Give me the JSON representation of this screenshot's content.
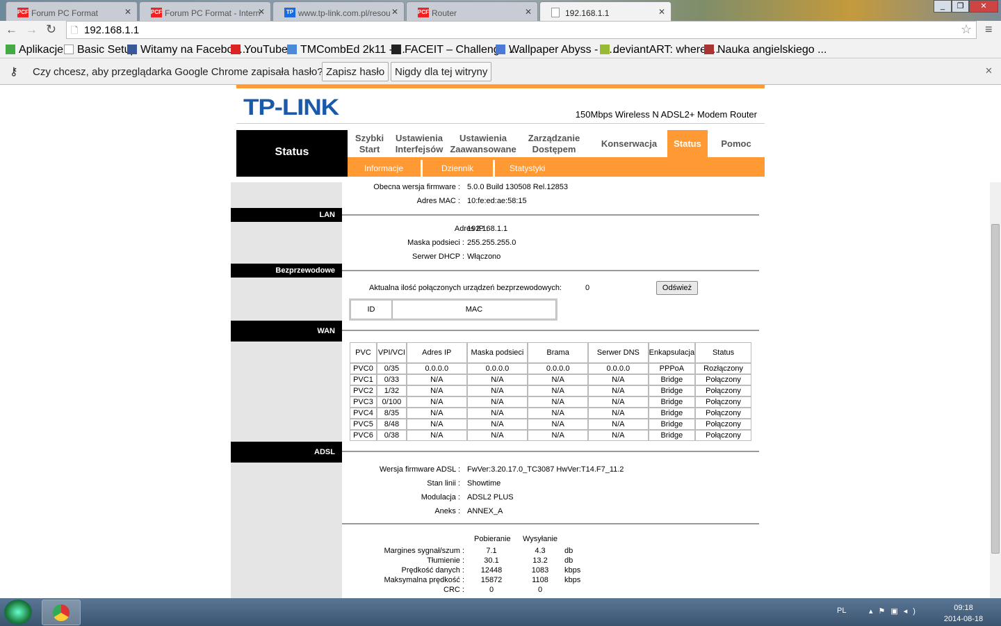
{
  "browser": {
    "tabs": [
      {
        "label": "Forum PC Format",
        "icon": "pcf"
      },
      {
        "label": "Forum PC Format - Intern",
        "icon": "pcf"
      },
      {
        "label": "www.tp-link.com.pl/resou",
        "icon": "tp"
      },
      {
        "label": "Router",
        "icon": "pcf"
      },
      {
        "label": "192.168.1.1",
        "icon": "page"
      }
    ],
    "url": "192.168.1.1",
    "bookmarks": [
      "Aplikacje",
      "Basic Setup",
      "Witamy na Faceboo...",
      "YouTube",
      "TMCombEd 2k11 - ...",
      "FACEIT – Challenge ...",
      "Wallpaper Abyss - C...",
      "deviantART: where ...",
      "Nauka angielskiego ..."
    ],
    "infobar": {
      "text": "Czy chcesz, aby przeglądarka Google Chrome zapisała hasło?",
      "save": "Zapisz hasło",
      "never": "Nigdy dla tej witryny"
    }
  },
  "router": {
    "logo": "TP-LINK",
    "model": "150Mbps Wireless N ADSL2+ Modem Router",
    "section_title": "Status",
    "nav": [
      [
        "Szybki",
        "Start"
      ],
      [
        "Ustawienia",
        "Interfejsów"
      ],
      [
        "Ustawienia",
        "Zaawansowane"
      ],
      [
        "Zarządzanie",
        "Dostępem"
      ],
      [
        "Konserwacja"
      ],
      [
        "Status"
      ],
      [
        "Pomoc"
      ]
    ],
    "subnav": [
      "Informacje",
      "Dziennik",
      "Statystyki"
    ],
    "device": {
      "fw_label": "Obecna wersja firmware :",
      "fw": "5.0.0 Build 130508 Rel.12853",
      "mac_label": "Adres MAC :",
      "mac": "10:fe:ed:ae:58:15"
    },
    "lan": {
      "title": "LAN",
      "ip_label": "Adres IP :",
      "ip": "192.168.1.1",
      "mask_label": "Maska podsieci :",
      "mask": "255.255.255.0",
      "dhcp_label": "Serwer DHCP :",
      "dhcp": "Włączono"
    },
    "wireless": {
      "title": "Bezprzewodowe",
      "count_label": "Aktualna ilość połączonych urządzeń bezprzewodowych:",
      "count": "0",
      "refresh": "Odśwież",
      "cols": [
        "ID",
        "MAC"
      ]
    },
    "wan": {
      "title": "WAN",
      "cols": [
        "PVC",
        "VPI/VCI",
        "Adres IP",
        "Maska podsieci",
        "Brama",
        "Serwer DNS",
        "Enkapsulacja",
        "Status"
      ],
      "rows": [
        [
          "PVC0",
          "0/35",
          "0.0.0.0",
          "0.0.0.0",
          "0.0.0.0",
          "0.0.0.0",
          "PPPoA",
          "Rozłączony"
        ],
        [
          "PVC1",
          "0/33",
          "N/A",
          "N/A",
          "N/A",
          "N/A",
          "Bridge",
          "Połączony"
        ],
        [
          "PVC2",
          "1/32",
          "N/A",
          "N/A",
          "N/A",
          "N/A",
          "Bridge",
          "Połączony"
        ],
        [
          "PVC3",
          "0/100",
          "N/A",
          "N/A",
          "N/A",
          "N/A",
          "Bridge",
          "Połączony"
        ],
        [
          "PVC4",
          "8/35",
          "N/A",
          "N/A",
          "N/A",
          "N/A",
          "Bridge",
          "Połączony"
        ],
        [
          "PVC5",
          "8/48",
          "N/A",
          "N/A",
          "N/A",
          "N/A",
          "Bridge",
          "Połączony"
        ],
        [
          "PVC6",
          "0/38",
          "N/A",
          "N/A",
          "N/A",
          "N/A",
          "Bridge",
          "Połączony"
        ]
      ]
    },
    "adsl": {
      "title": "ADSL",
      "fw_label": "Wersja firmware ADSL :",
      "fw": "FwVer:3.20.17.0_TC3087 HwVer:T14.F7_11.2",
      "line_label": "Stan linii :",
      "line": "Showtime",
      "mod_label": "Modulacja :",
      "mod": "ADSL2 PLUS",
      "annex_label": "Aneks :",
      "annex": "ANNEX_A",
      "stat_cols": [
        "Pobieranie",
        "Wysyłanie"
      ],
      "stats": [
        [
          "Margines sygnał/szum :",
          "7.1",
          "4.3",
          "db"
        ],
        [
          "Tłumienie :",
          "30.1",
          "13.2",
          "db"
        ],
        [
          "Prędkość danych :",
          "12448",
          "1083",
          "kbps"
        ],
        [
          "Maksymalna prędkość :",
          "15872",
          "1108",
          "kbps"
        ],
        [
          "CRC :",
          "0",
          "0",
          ""
        ]
      ]
    }
  },
  "taskbar": {
    "lang": "PL",
    "time": "09:18",
    "date": "2014-08-18"
  }
}
